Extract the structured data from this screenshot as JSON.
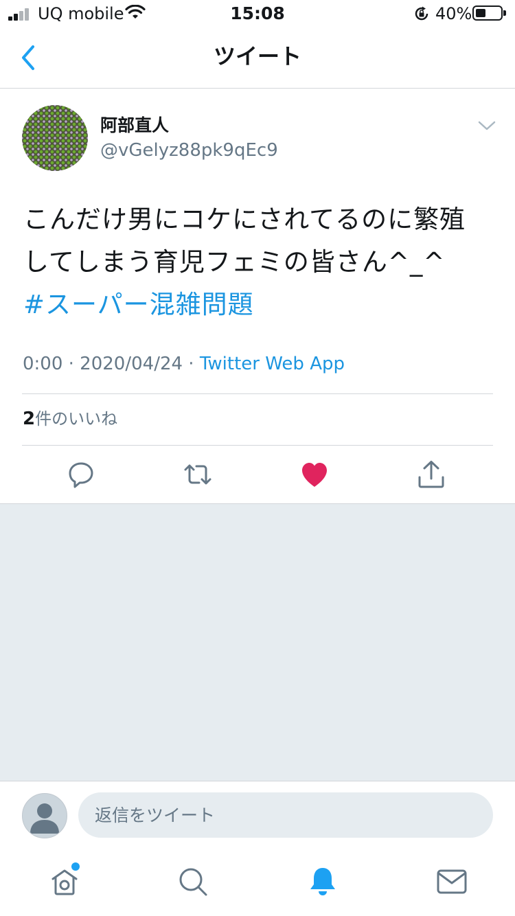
{
  "status_bar": {
    "carrier": "UQ mobile",
    "time": "15:08",
    "battery_percent": "40%"
  },
  "nav": {
    "title": "ツイート"
  },
  "tweet": {
    "display_name": "阿部直人",
    "handle": "@vGelyz88pk9qEc9",
    "text_line1": "こんだけ男にコケにされてるのに繁殖",
    "text_line2": "してしまう育児フェミの皆さん^_^",
    "hashtag": "#スーパー混雑問題",
    "timestamp": "0:00 · 2020/04/24 · ",
    "source": "Twitter Web App",
    "like_count": "2",
    "like_label": "件のいいね"
  },
  "reply": {
    "placeholder": "返信をツイート"
  },
  "colors": {
    "accent": "#1da1f2",
    "like": "#e0245e",
    "secondary_text": "#657786"
  },
  "icons": {
    "back": "chevron-left-icon",
    "caret": "chevron-down-icon",
    "reply": "comment-icon",
    "retweet": "retweet-icon",
    "like": "heart-icon",
    "share": "share-icon",
    "home": "home-icon",
    "search": "search-icon",
    "notifications": "bell-icon",
    "messages": "envelope-icon"
  }
}
